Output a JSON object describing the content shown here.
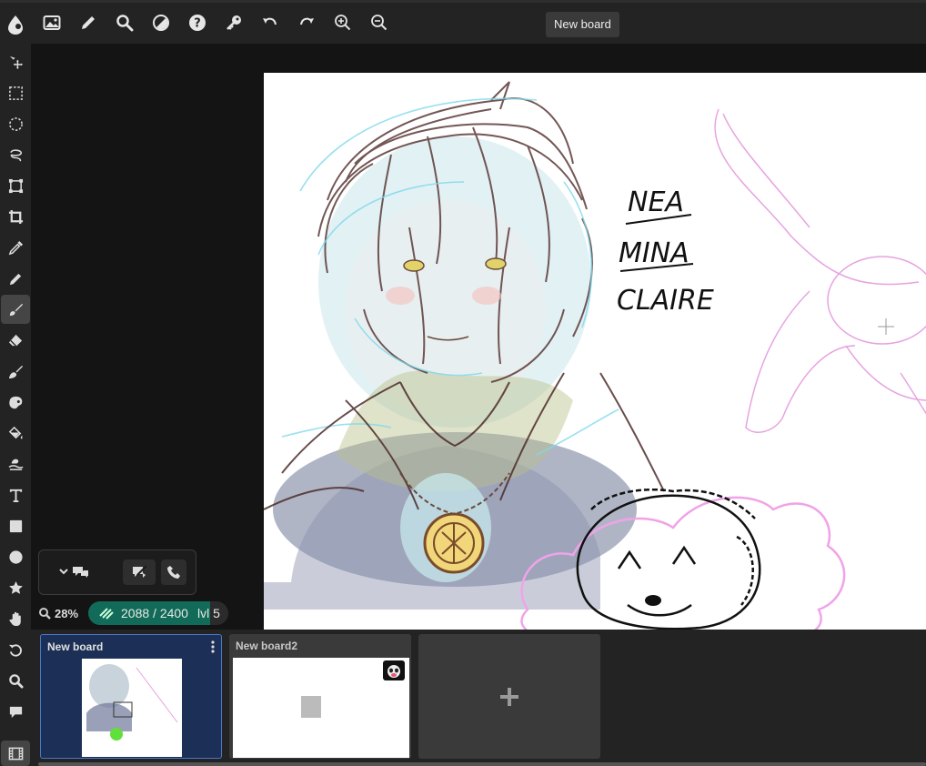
{
  "app": {
    "board_title": "New board"
  },
  "toolbar": {
    "buttons": [
      "image-icon",
      "pencil-icon",
      "search-icon",
      "contrast-icon",
      "help-icon",
      "key-icon",
      "undo-icon",
      "redo-icon",
      "zoom-in-icon",
      "zoom-out-icon"
    ]
  },
  "tools": [
    "move",
    "rect-select",
    "ellipse-select",
    "lasso",
    "transform",
    "crop",
    "eyedropper",
    "pencil",
    "brush",
    "eraser",
    "smudge",
    "blob",
    "fill",
    "stamp",
    "text",
    "rectangle",
    "ellipse",
    "star",
    "hand",
    "rotate",
    "zoom",
    "comment",
    "film"
  ],
  "canvas": {
    "text_lines": [
      "NEA",
      "MINA",
      "CLAIRE"
    ]
  },
  "status": {
    "zoom": "28%",
    "progress_text": "2088 / 2400",
    "progress_fraction": 0.87,
    "level": "lvl 5"
  },
  "boards": [
    {
      "name": "New board",
      "active": true
    },
    {
      "name": "New board2",
      "active": false
    }
  ],
  "colors": {
    "accent": "#116b58",
    "active_board": "#1c2f56",
    "panel": "#232323"
  }
}
